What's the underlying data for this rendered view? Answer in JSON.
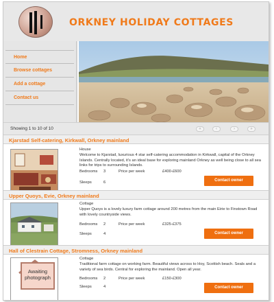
{
  "header": {
    "title": "ORKNEY HOLIDAY COTTAGES",
    "logo_icon": "cottage-logo-icon"
  },
  "nav": {
    "items": [
      {
        "label": "Home"
      },
      {
        "label": "Browse cottages"
      },
      {
        "label": "Add a cottage"
      },
      {
        "label": "Contact us"
      }
    ]
  },
  "pager": {
    "showing": "Showing 1 to 10 of 10",
    "buttons": [
      "«",
      "‹",
      "›",
      "»"
    ]
  },
  "labels": {
    "bedrooms": "Bedrooms",
    "sleeps": "Sleeps",
    "price_per_week": "Price per week",
    "contact_button": "Contact owner"
  },
  "listings": [
    {
      "title": "Kjarstad Self-catering, Kirkwall, Orkney mainland",
      "type": "House",
      "description": "Welcome to Kjarstad, luxurious 4 star self-catering accommodation in Kirkwall, capital of the Orkney Islands. Centrally located, it's an ideal base for exploring mainland Orkney as well being close to all sea links for trips to surrounding Islands.",
      "bedrooms": "3",
      "sleeps": "6",
      "price": "£400-£600",
      "image": "cottage-interior-photo"
    },
    {
      "title": "Upper Quoys, Evie, Orkney mainland",
      "type": "Cottage",
      "description": "Upper Quoys is a lovely luxury farm cottage around 200 metres from the main Eirie to Finstown Road with lovely countryside views.",
      "bedrooms": "2",
      "sleeps": "4",
      "price": "£325-£375",
      "image": "cottage-exterior-photo"
    },
    {
      "title": "Hall of Clestrain Cottage, Stromness, Orkney mainland",
      "type": "Cottage",
      "description": "Traditional farm cottage on working farm. Beautiful views across to Hoy, Scottish beach. Seals and a variety of sea birds. Central for exploring the mainland. Open all year.",
      "bedrooms": "2",
      "sleeps": "4",
      "price": "£150-£300",
      "placeholder_text": "Awaiting photograph"
    }
  ],
  "colors": {
    "accent": "#f07a1a",
    "button": "#ef6f10",
    "header_bg": "#e8e8e8"
  }
}
